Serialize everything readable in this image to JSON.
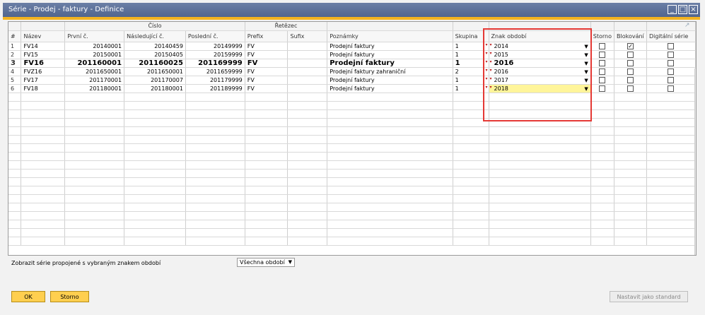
{
  "window": {
    "title": "Série - Prodej - faktury - Definice"
  },
  "grid": {
    "groups": {
      "cislo": "Číslo",
      "retezec": "Řetězec"
    },
    "columns": {
      "num": "#",
      "nazev": "Název",
      "prvni": "První č.",
      "nasledujici": "Následující č.",
      "posledni": "Poslední č.",
      "prefix": "Prefix",
      "sufix": "Sufix",
      "poznamky": "Poznámky",
      "skupina": "Skupina",
      "znak": "Znak období",
      "storno": "Storno",
      "blokovani": "Blokování",
      "digitalni": "Digitální série"
    },
    "rows": [
      {
        "num": "1",
        "nazev": "FV14",
        "prvni": "20140001",
        "nasledujici": "20140459",
        "posledni": "20149999",
        "prefix": "FV",
        "sufix": "",
        "poznamky": "Prodejní faktury",
        "skupina": "1",
        "znak": "2014",
        "storno": false,
        "blokovani": true,
        "digitalni": false
      },
      {
        "num": "2",
        "nazev": "FV15",
        "prvni": "20150001",
        "nasledujici": "20150405",
        "posledni": "20159999",
        "prefix": "FV",
        "sufix": "",
        "poznamky": "Prodejní faktury",
        "skupina": "1",
        "znak": "2015",
        "storno": false,
        "blokovani": false,
        "digitalni": false
      },
      {
        "num": "3",
        "nazev": "FV16",
        "prvni": "201160001",
        "nasledujici": "201160025",
        "posledni": "201169999",
        "prefix": "FV",
        "sufix": "",
        "poznamky": "Prodejní faktury",
        "skupina": "1",
        "znak": "2016",
        "storno": false,
        "blokovani": false,
        "digitalni": false
      },
      {
        "num": "4",
        "nazev": "FVZ16",
        "prvni": "2011650001",
        "nasledujici": "2011650001",
        "posledni": "2011659999",
        "prefix": "FV",
        "sufix": "",
        "poznamky": "Prodejní faktury zahraniční",
        "skupina": "2",
        "znak": "2016",
        "storno": false,
        "blokovani": false,
        "digitalni": false
      },
      {
        "num": "5",
        "nazev": "FV17",
        "prvni": "201170001",
        "nasledujici": "201170007",
        "posledni": "201179999",
        "prefix": "FV",
        "sufix": "",
        "poznamky": "Prodejní faktury",
        "skupina": "1",
        "znak": "2017",
        "storno": false,
        "blokovani": false,
        "digitalni": false
      },
      {
        "num": "6",
        "nazev": "FV18",
        "prvni": "201180001",
        "nasledujici": "201180001",
        "posledni": "201189999",
        "prefix": "FV",
        "sufix": "",
        "poznamky": "Prodejní faktury",
        "skupina": "1",
        "znak": "2018",
        "storno": false,
        "blokovani": false,
        "digitalni": false
      }
    ],
    "bold_row": 2,
    "selected_row": 5,
    "empty_rows": 18
  },
  "filter": {
    "label": "Zobrazit série propojené s vybraným znakem období",
    "value": "Všechna období"
  },
  "buttons": {
    "ok": "OK",
    "storno": "Storno",
    "standard": "Nastavit jako standard"
  },
  "colors": {
    "accent": "#f3b320",
    "highlight": "#e53935",
    "selected_cell": "#fff59a",
    "titlebar": "#5a6d95"
  }
}
